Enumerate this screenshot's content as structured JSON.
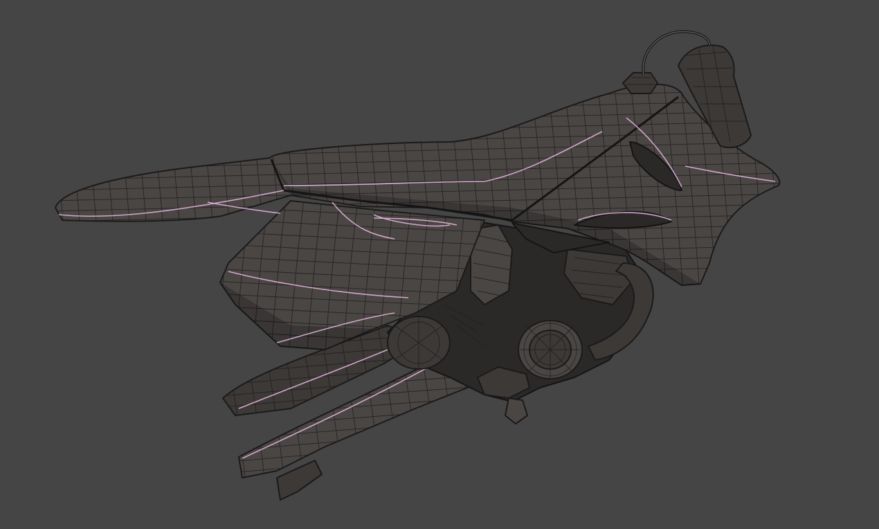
{
  "viewport": {
    "background_color": "#454545",
    "mesh_color": "#4a4644",
    "wire_color": "#1f1e1e",
    "seam_color": "#e2b4dc",
    "display_mode": "wireframe-on-shaded"
  }
}
